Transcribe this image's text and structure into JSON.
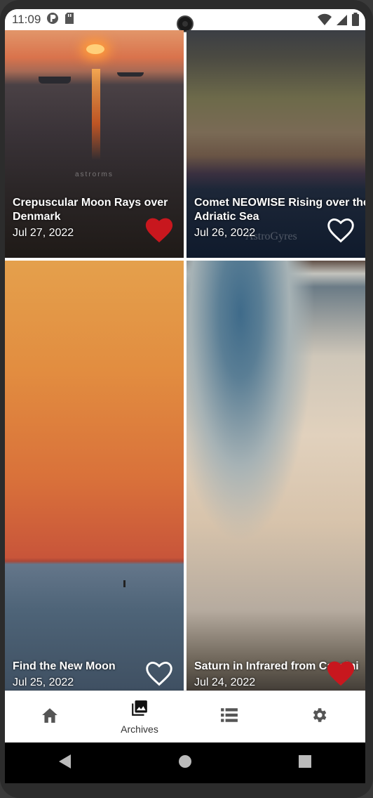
{
  "status_bar": {
    "time": "11:09"
  },
  "cards": [
    {
      "title": "Crepuscular Moon Rays over Denmark",
      "date": "Jul 27, 2022",
      "favorited": true,
      "watermark": "astrorms"
    },
    {
      "title": "Comet NEOWISE Rising over the Adriatic Sea",
      "date": "Jul 26, 2022",
      "favorited": false,
      "watermark": "AstroGyres"
    },
    {
      "title": "Find the New Moon",
      "date": "Jul 25, 2022",
      "favorited": false
    },
    {
      "title": "Saturn in Infrared from Cassini",
      "date": "Jul 24, 2022",
      "favorited": true
    }
  ],
  "bottom_nav": {
    "items": [
      {
        "icon": "home-icon",
        "label": "",
        "active": false
      },
      {
        "icon": "photo-library-icon",
        "label": "Archives",
        "active": true
      },
      {
        "icon": "list-icon",
        "label": "",
        "active": false
      },
      {
        "icon": "gear-icon",
        "label": "",
        "active": false
      }
    ]
  },
  "colors": {
    "heart_filled": "#c8171e",
    "heart_outline": "#ffffff",
    "nav_icon": "#555555"
  }
}
